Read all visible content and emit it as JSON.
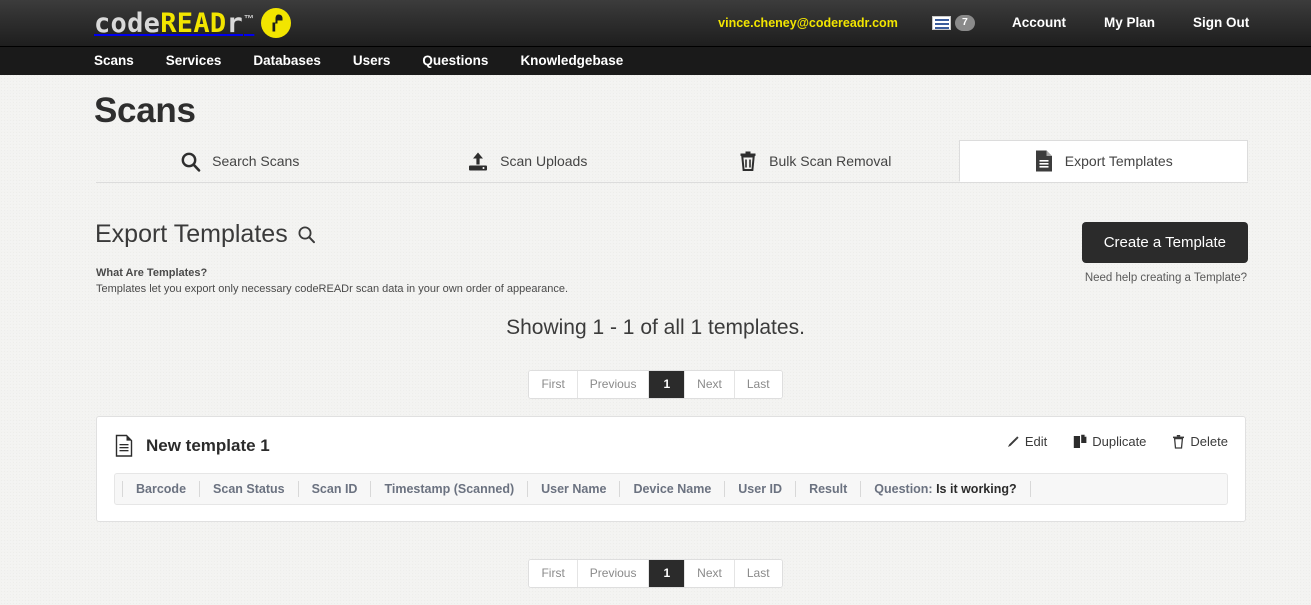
{
  "header": {
    "logo": {
      "part1": "code",
      "part2": "READ",
      "part3": "r",
      "tm": "™",
      "badge_icon": "barcode-scanner-icon"
    },
    "user_email": "vince.cheney@codereadr.com",
    "messages_icon": "messages-icon",
    "messages_count": "7",
    "links": [
      {
        "label": "Account"
      },
      {
        "label": "My Plan"
      },
      {
        "label": "Sign Out"
      }
    ]
  },
  "nav": {
    "items": [
      {
        "label": "Scans"
      },
      {
        "label": "Services"
      },
      {
        "label": "Databases"
      },
      {
        "label": "Users"
      },
      {
        "label": "Questions"
      },
      {
        "label": "Knowledgebase"
      }
    ]
  },
  "page": {
    "title": "Scans"
  },
  "tabs": [
    {
      "label": "Search Scans",
      "icon": "search-icon",
      "active": false
    },
    {
      "label": "Scan Uploads",
      "icon": "upload-icon",
      "active": false
    },
    {
      "label": "Bulk Scan Removal",
      "icon": "trash-icon",
      "active": false
    },
    {
      "label": "Export Templates",
      "icon": "document-icon",
      "active": true
    }
  ],
  "section": {
    "title": "Export Templates",
    "title_icon": "search-icon",
    "note_heading": "What Are Templates?",
    "note_body": "Templates let you export only necessary codeREADr scan data in your own order of appearance.",
    "create_button": "Create a Template",
    "help_text": "Need help creating a Template?",
    "showing": "Showing 1 - 1 of all 1 templates."
  },
  "pagination": {
    "first": "First",
    "previous": "Previous",
    "current": "1",
    "next": "Next",
    "last": "Last"
  },
  "template": {
    "icon": "document-icon",
    "name": "New template 1",
    "actions": [
      {
        "label": "Edit",
        "icon": "pencil-icon"
      },
      {
        "label": "Duplicate",
        "icon": "duplicate-icon"
      },
      {
        "label": "Delete",
        "icon": "trash-icon"
      }
    ],
    "fields": [
      {
        "label": "Barcode"
      },
      {
        "label": "Scan Status"
      },
      {
        "label": "Scan ID"
      },
      {
        "label": "Timestamp (Scanned)"
      },
      {
        "label": "User Name"
      },
      {
        "label": "Device Name"
      },
      {
        "label": "User ID"
      },
      {
        "label": "Result"
      }
    ],
    "question_prefix": "Question: ",
    "question_value": "Is it working?"
  },
  "colors": {
    "brand_yellow": "#f2e500",
    "header_dark": "#303030",
    "nav_dark": "#1a1a1a",
    "page_bg": "#f3f3f1",
    "accent_dark": "#2b2b2b"
  }
}
